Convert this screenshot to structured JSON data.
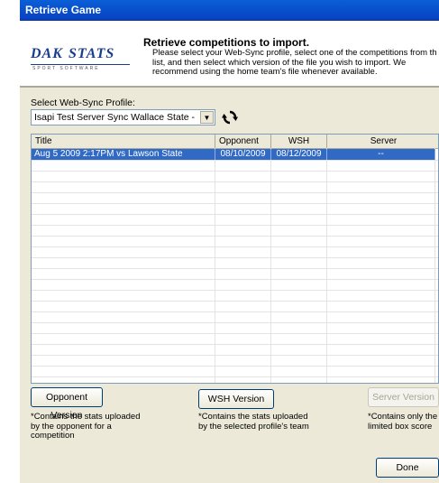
{
  "window": {
    "title": "Retrieve Game"
  },
  "header": {
    "logo_word1": "DAK",
    "logo_word2": "STATS",
    "logo_sub": "SPORT SOFTWARE",
    "title": "Retrieve competitions to import.",
    "description": "Please select your Web-Sync profile, select one of the competitions from th\nlist, and then select which version of the file you wish to import. We\nrecommend using the home team's file whenever available."
  },
  "profile": {
    "label": "Select Web-Sync Profile:",
    "value": "Isapi Test Server Sync Wallace State -"
  },
  "grid": {
    "columns": [
      "Title",
      "Opponent",
      "WSH",
      "Server"
    ],
    "rows": [
      {
        "title": "Aug  5 2009  2:17PM vs Lawson State",
        "opponent": "08/10/2009",
        "wsh": "08/12/2009",
        "server": "--"
      }
    ]
  },
  "buttons": {
    "opponent": "Opponent Version",
    "wsh": "WSH Version",
    "server": "Server Version",
    "done": "Done"
  },
  "notes": {
    "opponent": "*Contains the stats uploaded\nby the opponent for a\ncompetition",
    "wsh": "*Contains the stats uploaded\nby the selected profile's team",
    "server": "*Contains only the\nlimited box score"
  }
}
